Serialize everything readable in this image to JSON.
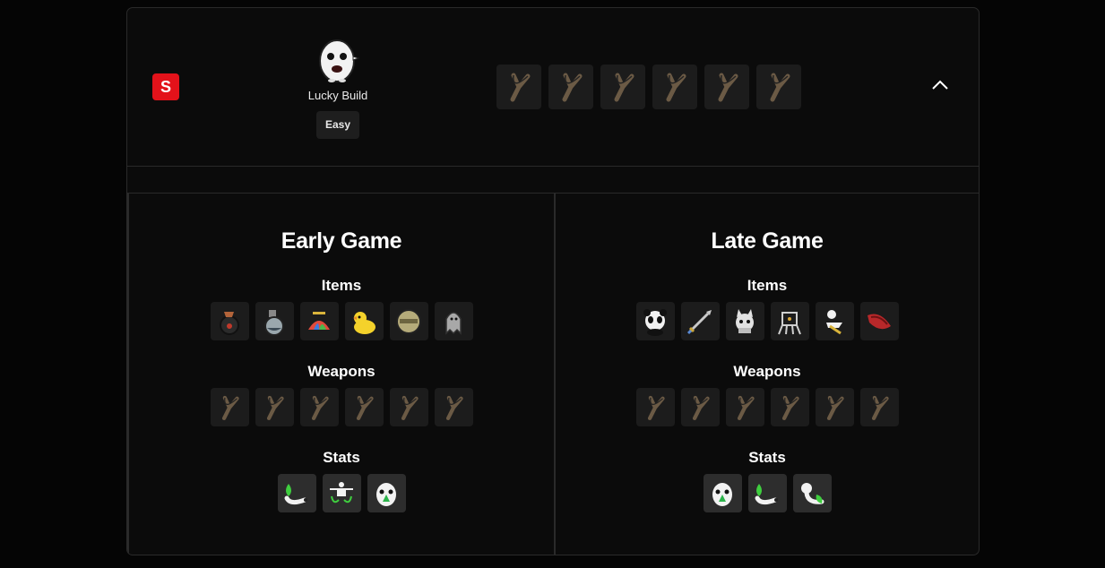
{
  "build": {
    "tier": "S",
    "character_name": "Lucky Build",
    "difficulty": "Easy",
    "character_portrait_icon": "egg-creature-icon",
    "weapons": [
      "slingshot-icon",
      "slingshot-icon",
      "slingshot-icon",
      "slingshot-icon",
      "slingshot-icon",
      "slingshot-icon"
    ],
    "collapse_icon": "chevron-up-icon"
  },
  "early_game": {
    "title": "Early Game",
    "items_label": "Items",
    "items": [
      "bag-bomb-icon",
      "potion-flask-icon",
      "propeller-hat-icon",
      "rubber-duck-icon",
      "helmet-icon",
      "ghost-icon"
    ],
    "weapons_label": "Weapons",
    "weapons": [
      "slingshot-icon",
      "slingshot-icon",
      "slingshot-icon",
      "slingshot-icon",
      "slingshot-icon",
      "slingshot-icon"
    ],
    "stats_label": "Stats",
    "stats": [
      "arm-stat-icon",
      "drone-stat-icon",
      "luck-egg-stat-icon"
    ]
  },
  "late_game": {
    "title": "Late Game",
    "items_label": "Items",
    "items": [
      "panda-icon",
      "sword-icon",
      "cat-icon",
      "robot-icon",
      "skeleton-icon",
      "red-fish-icon"
    ],
    "weapons_label": "Weapons",
    "weapons": [
      "slingshot-icon",
      "slingshot-icon",
      "slingshot-icon",
      "slingshot-icon",
      "slingshot-icon",
      "slingshot-icon"
    ],
    "stats_label": "Stats",
    "stats": [
      "luck-egg-stat-icon",
      "arm-stat-icon",
      "arm-strength-stat-icon"
    ]
  },
  "colors": {
    "background": "#050505",
    "card": "#0b0b0b",
    "border": "#2a2a2a",
    "tier_s": "#e3121a",
    "tile": "#1c1c1c",
    "stat_tile": "#2d2d2d"
  }
}
